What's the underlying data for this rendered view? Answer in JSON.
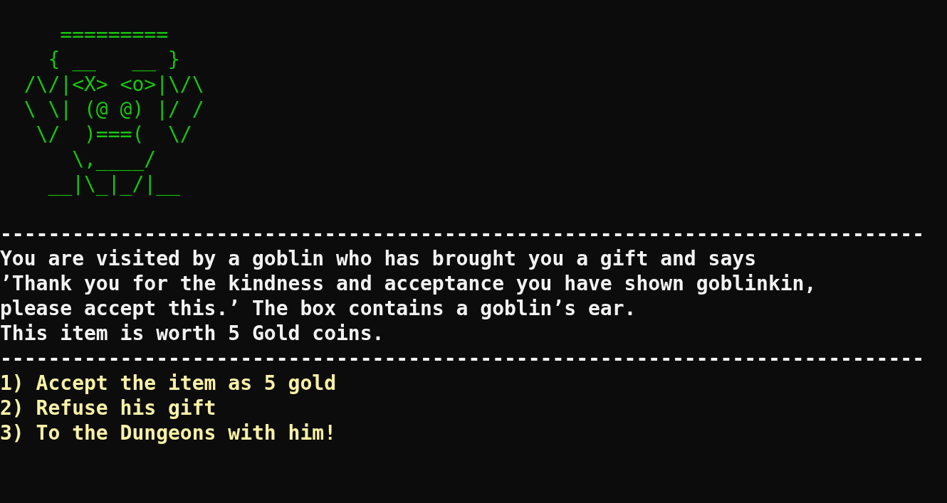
{
  "art": [
    "     =========",
    "    { __   __ }",
    "  /\\/|<X> <o>|\\/\\",
    "  \\ \\| (@ @) |/ /",
    "   \\/  )===(  \\/",
    "      \\,____/",
    "    __|\\_|_/|__"
  ],
  "separator_top": "-----------------------------------------------------------------------------",
  "message": [
    "You are visited by a goblin who has brought you a gift and says",
    "’Thank you for the kindness and acceptance you have shown goblinkin,",
    "please accept this.’ The box contains a goblin’s ear.",
    "This item is worth 5 Gold coins."
  ],
  "separator_bottom": "-----------------------------------------------------------------------------",
  "options": [
    "1) Accept the item as 5 gold",
    "2) Refuse his gift",
    "3) To the Dungeons with him!"
  ]
}
